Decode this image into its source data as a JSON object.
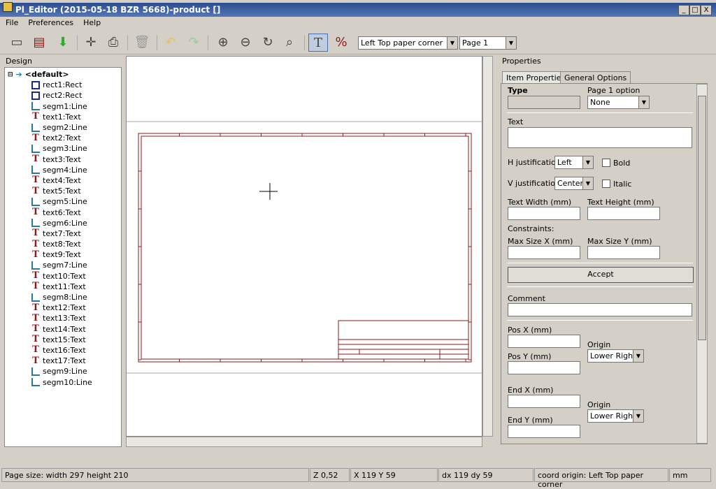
{
  "window": {
    "title": "Pl_Editor (2015-05-18 BZR 5668)-product []",
    "minimize": "_",
    "maximize": "□",
    "close": "X"
  },
  "menu": [
    "File",
    "Preferences",
    "Help"
  ],
  "toolbar": {
    "icons": [
      "new-page-icon",
      "load-layout-icon",
      "save-icon",
      "page-settings-icon",
      "print-icon",
      "delete-icon",
      "undo-icon",
      "redo-icon",
      "zoom-in-icon",
      "zoom-out-icon",
      "redraw-icon",
      "zoom-fit-icon",
      "text-mode-icon",
      "percent-mode-icon"
    ],
    "origin_select": "Left Top paper corner",
    "page_select": "Page 1"
  },
  "design": {
    "header": "Design",
    "root": "<default>",
    "items": [
      {
        "label": "rect1:Rect",
        "type": "rect"
      },
      {
        "label": "rect2:Rect",
        "type": "rect"
      },
      {
        "label": "segm1:Line",
        "type": "line"
      },
      {
        "label": "text1:Text",
        "type": "text"
      },
      {
        "label": "segm2:Line",
        "type": "line"
      },
      {
        "label": "text2:Text",
        "type": "text"
      },
      {
        "label": "segm3:Line",
        "type": "line"
      },
      {
        "label": "text3:Text",
        "type": "text"
      },
      {
        "label": "segm4:Line",
        "type": "line"
      },
      {
        "label": "text4:Text",
        "type": "text"
      },
      {
        "label": "text5:Text",
        "type": "text"
      },
      {
        "label": "segm5:Line",
        "type": "line"
      },
      {
        "label": "text6:Text",
        "type": "text"
      },
      {
        "label": "segm6:Line",
        "type": "line"
      },
      {
        "label": "text7:Text",
        "type": "text"
      },
      {
        "label": "text8:Text",
        "type": "text"
      },
      {
        "label": "text9:Text",
        "type": "text"
      },
      {
        "label": "segm7:Line",
        "type": "line"
      },
      {
        "label": "text10:Text",
        "type": "text"
      },
      {
        "label": "text11:Text",
        "type": "text"
      },
      {
        "label": "segm8:Line",
        "type": "line"
      },
      {
        "label": "text12:Text",
        "type": "text"
      },
      {
        "label": "text13:Text",
        "type": "text"
      },
      {
        "label": "text14:Text",
        "type": "text"
      },
      {
        "label": "text15:Text",
        "type": "text"
      },
      {
        "label": "text16:Text",
        "type": "text"
      },
      {
        "label": "text17:Text",
        "type": "text"
      },
      {
        "label": "segm9:Line",
        "type": "line"
      },
      {
        "label": "segm10:Line",
        "type": "line"
      }
    ]
  },
  "properties": {
    "header": "Properties",
    "tabs": [
      "Item Properties",
      "General Options"
    ],
    "type_label": "Type",
    "page1_label": "Page 1 option",
    "page1_value": "None",
    "text_label": "Text",
    "hjust_label": "H justification",
    "hjust_value": "Left",
    "bold_label": "Bold",
    "vjust_label": "V justification",
    "vjust_value": "Center",
    "italic_label": "Italic",
    "text_width_label": "Text Width (mm)",
    "text_height_label": "Text Height (mm)",
    "constraints_label": "Constraints:",
    "max_x_label": "Max Size X (mm)",
    "max_y_label": "Max Size Y (mm)",
    "accept_label": "Accept",
    "comment_label": "Comment",
    "posx_label": "Pos X (mm)",
    "posy_label": "Pos Y (mm)",
    "origin_label": "Origin",
    "origin1_value": "Lower Right",
    "endx_label": "End X (mm)",
    "endy_label": "End Y (mm)",
    "origin2_value": "Lower Right"
  },
  "status": {
    "page_size": "Page size: width 297 height 210",
    "zoom": "Z 0,52",
    "xy": "X 119  Y 59",
    "dxdy": "dx 119  dy 59",
    "origin": "coord origin: Left Top paper corner",
    "units": "mm"
  },
  "colors": {
    "title_bar": "#2a4d8f",
    "frame": "#8b1a1a"
  }
}
